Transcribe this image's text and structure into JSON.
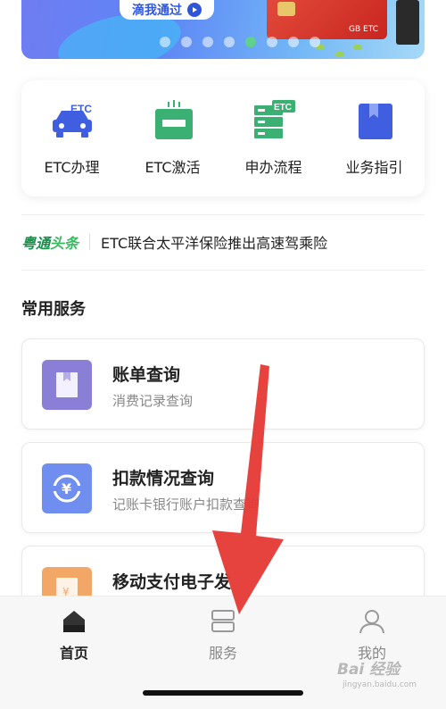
{
  "banner": {
    "button_label": "滴我通过",
    "card_text": "GB ETC",
    "dot_count": 8,
    "active_dot_index": 4
  },
  "quick_actions": [
    {
      "label": "ETC办理",
      "icon": "car-etc-icon"
    },
    {
      "label": "ETC激活",
      "icon": "device-activate-icon"
    },
    {
      "label": "申办流程",
      "icon": "server-etc-icon"
    },
    {
      "label": "业务指引",
      "icon": "book-icon"
    }
  ],
  "news": {
    "brand_a": "粤通",
    "brand_b": "头条",
    "headline": "ETC联合太平洋保险推出高速驾乘险"
  },
  "section": {
    "title": "常用服务"
  },
  "services": [
    {
      "title": "账单查询",
      "desc": "消费记录查询",
      "icon": "bill-icon",
      "color": "#8a7fd6"
    },
    {
      "title": "扣款情况查询",
      "desc": "记账卡银行账户扣款查询",
      "icon": "deduction-icon",
      "color": "#6f8ef0"
    },
    {
      "title": "移动支付电子发",
      "desc": "",
      "icon": "invoice-icon",
      "color": "#f2a766"
    }
  ],
  "tabs": [
    {
      "label": "首页",
      "icon": "home-icon",
      "active": true
    },
    {
      "label": "服务",
      "icon": "services-icon",
      "active": false
    },
    {
      "label": "我的",
      "icon": "user-icon",
      "active": false
    }
  ],
  "watermark": {
    "main": "Bai 经验",
    "sub": "jingyan.baidu.com"
  },
  "colors": {
    "accent_green": "#1a8f4c",
    "icon_blue": "#3f5fe0",
    "icon_green": "#3bb073",
    "arrow_red": "#e53935"
  }
}
